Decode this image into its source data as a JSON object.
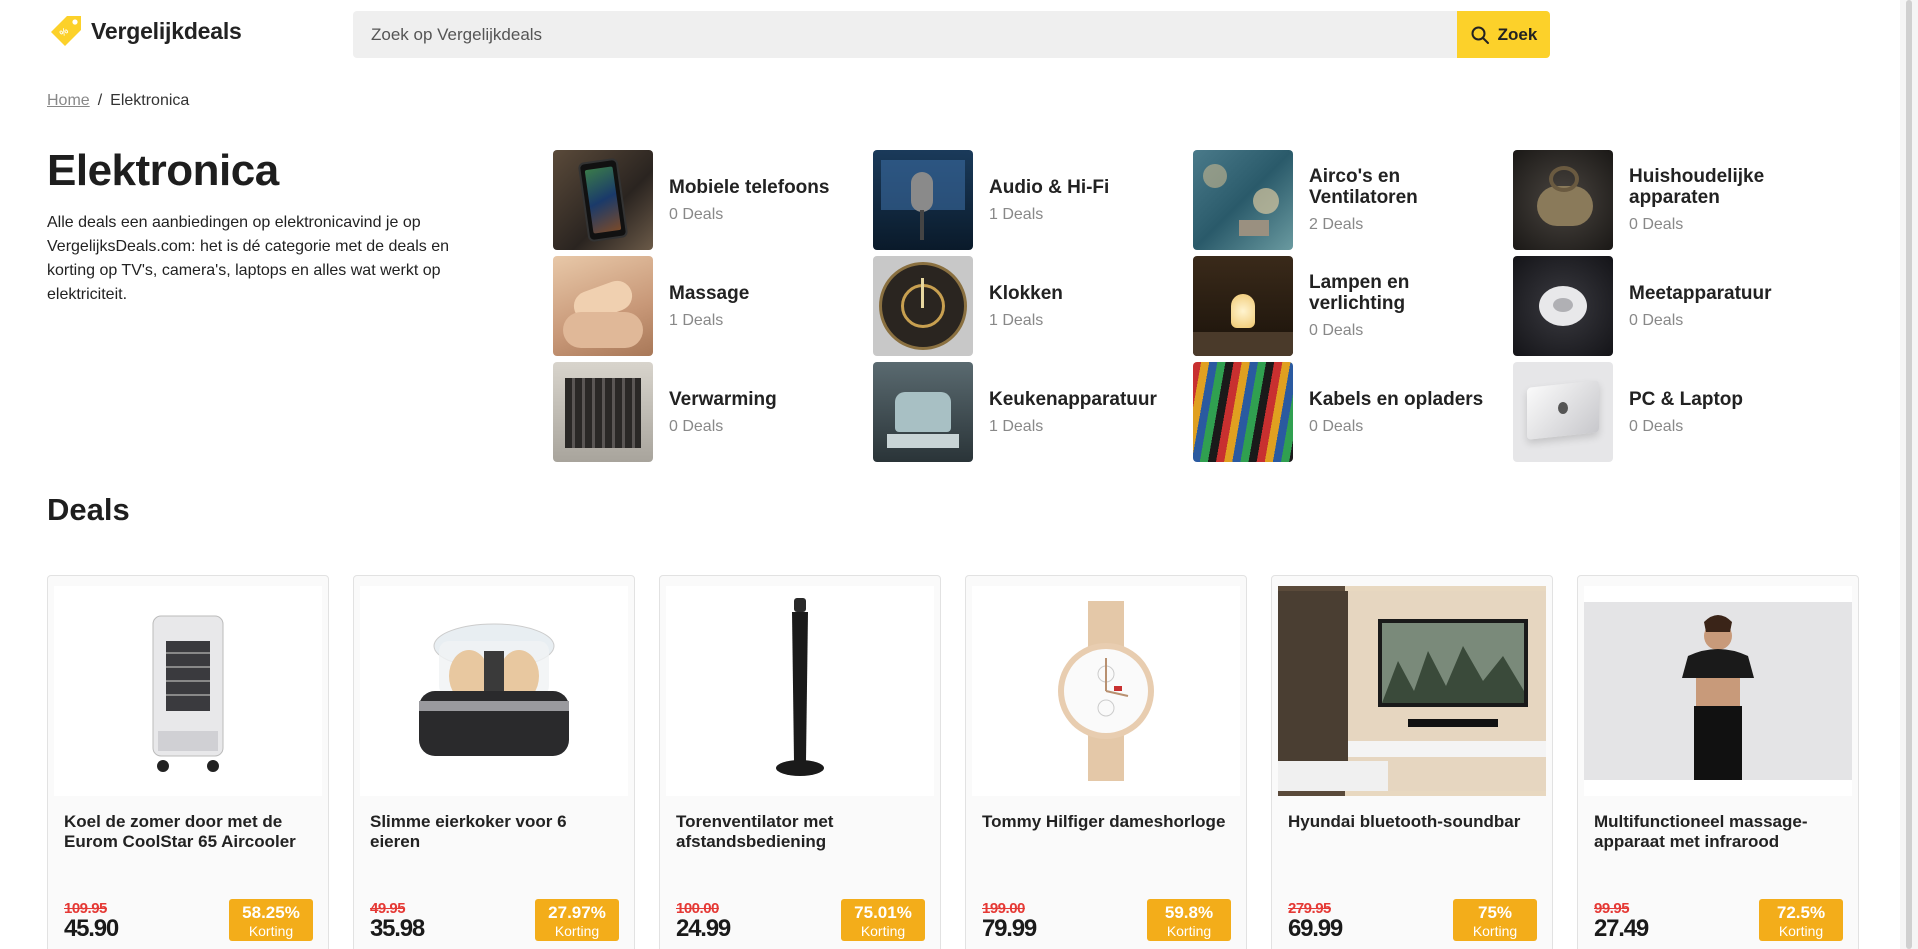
{
  "header": {
    "logo_text": "Vergelijkdeals",
    "search_placeholder": "Zoek op Vergelijkdeals",
    "search_button": "Zoek",
    "accent_color": "#fcd12a"
  },
  "breadcrumb": {
    "home": "Home",
    "separator": "/",
    "current": "Elektronica"
  },
  "intro": {
    "title": "Elektronica",
    "description": "Alle deals een aanbiedingen op elektronicavind je op VergelijksDeals.com: het is dé categorie met de deals en korting op TV's, camera's, laptops en alles wat werkt op elektriciteit."
  },
  "categories": [
    {
      "name": "Mobiele telefoons",
      "count": "0 Deals",
      "icon": "phone-photo"
    },
    {
      "name": "Audio & Hi-Fi",
      "count": "1 Deals",
      "icon": "microphone-photo"
    },
    {
      "name": "Airco's en Ventilatoren",
      "count": "2 Deals",
      "icon": "fan-photo"
    },
    {
      "name": "Huishoudelijke apparaten",
      "count": "0 Deals",
      "icon": "vacuum-photo"
    },
    {
      "name": "Massage",
      "count": "1 Deals",
      "icon": "massage-photo"
    },
    {
      "name": "Klokken",
      "count": "1 Deals",
      "icon": "clock-photo"
    },
    {
      "name": "Lampen en verlichting",
      "count": "0 Deals",
      "icon": "lamp-photo"
    },
    {
      "name": "Meetapparatuur",
      "count": "0 Deals",
      "icon": "detector-photo"
    },
    {
      "name": "Verwarming",
      "count": "0 Deals",
      "icon": "radiator-photo"
    },
    {
      "name": "Keukenapparatuur",
      "count": "1 Deals",
      "icon": "mixer-photo"
    },
    {
      "name": "Kabels en opladers",
      "count": "0 Deals",
      "icon": "cables-photo"
    },
    {
      "name": "PC & Laptop",
      "count": "0 Deals",
      "icon": "laptop-photo"
    }
  ],
  "deals_section": {
    "title": "Deals",
    "discount_label": "Korting",
    "discount_color": "#f3ad1a",
    "old_price_color": "#e53935"
  },
  "deals": [
    {
      "title": "Koel de zomer door met de Eurom CoolStar 65 Aircooler",
      "old_price": "109.95",
      "new_price": "45.90",
      "discount": "58.25%",
      "icon": "aircooler-image"
    },
    {
      "title": "Slimme eierkoker voor 6 eieren",
      "old_price": "49.95",
      "new_price": "35.98",
      "discount": "27.97%",
      "icon": "egg-cooker-image"
    },
    {
      "title": "Torenventilator met afstandsbediening",
      "old_price": "100.00",
      "new_price": "24.99",
      "discount": "75.01%",
      "icon": "tower-fan-image"
    },
    {
      "title": "Tommy Hilfiger dameshorloge",
      "old_price": "199.00",
      "new_price": "79.99",
      "discount": "59.8%",
      "icon": "watch-image"
    },
    {
      "title": "Hyundai bluetooth-soundbar",
      "old_price": "279.95",
      "new_price": "69.99",
      "discount": "75%",
      "icon": "soundbar-image"
    },
    {
      "title": "Multifunctioneel massage-apparaat met infrarood",
      "old_price": "99.95",
      "new_price": "27.49",
      "discount": "72.5%",
      "icon": "massager-image"
    }
  ]
}
